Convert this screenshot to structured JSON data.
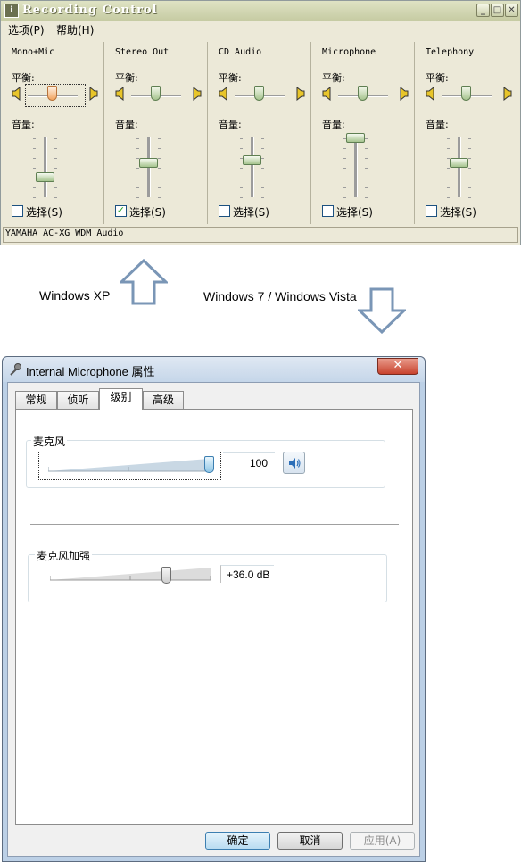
{
  "xp": {
    "title": "Recording Control",
    "menu": [
      "选项(P)",
      "帮助(H)"
    ],
    "balance_label": "平衡:",
    "volume_label": "音量:",
    "select_label": "选择(S)",
    "channels": [
      {
        "name": "Mono+Mic",
        "selected": false,
        "volume": 0.3,
        "balance": 0.5
      },
      {
        "name": "Stereo Out",
        "selected": true,
        "volume": 0.55,
        "balance": 0.5
      },
      {
        "name": "CD Audio",
        "selected": false,
        "volume": 0.6,
        "balance": 0.5
      },
      {
        "name": "Microphone",
        "selected": false,
        "volume": 0.98,
        "balance": 0.5
      },
      {
        "name": "Telephony",
        "selected": false,
        "volume": 0.55,
        "balance": 0.5
      }
    ],
    "status": "YAMAHA AC-XG WDM Audio"
  },
  "captions": {
    "xp": "Windows XP",
    "vista": "Windows 7 / Windows Vista"
  },
  "vista": {
    "title": "Internal Microphone 属性",
    "tabs": [
      "常规",
      "侦听",
      "级别",
      "高级"
    ],
    "active_tab": 2,
    "mic_group": {
      "label": "麦克风",
      "value": "100",
      "level": 1.0
    },
    "boost_group": {
      "label": "麦克风加强",
      "value": "+36.0 dB",
      "level": 0.72
    },
    "buttons": {
      "ok": "确定",
      "cancel": "取消",
      "apply": "应用(A)"
    }
  }
}
